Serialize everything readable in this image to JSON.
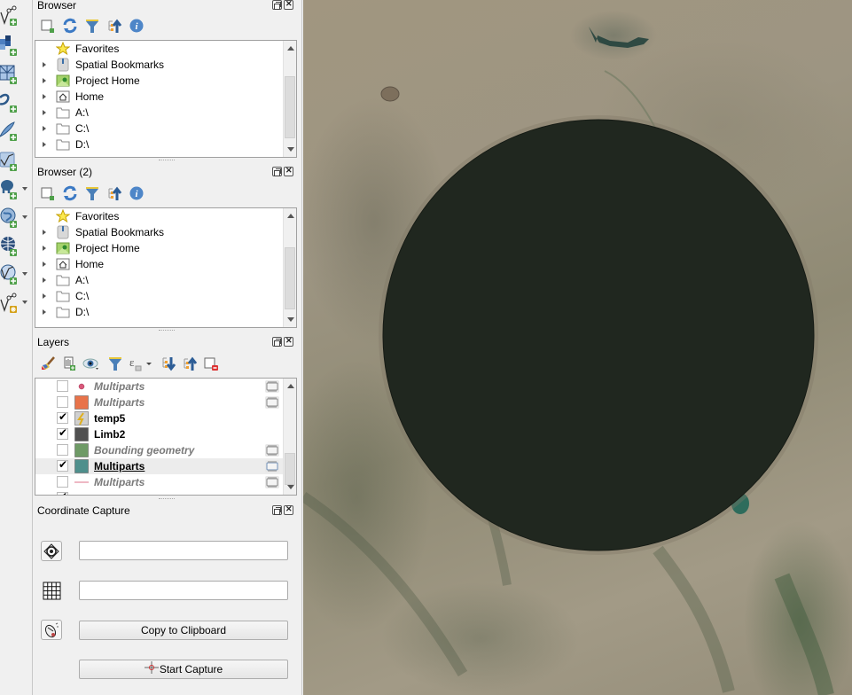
{
  "left_toolbar": {
    "buttons": [
      {
        "name": "add-vector-layer",
        "icon": "vector-add-icon",
        "has_menu": false
      },
      {
        "name": "add-raster-layer",
        "icon": "raster-add-icon",
        "has_menu": false
      },
      {
        "name": "add-mesh-layer",
        "icon": "mesh-add-icon",
        "has_menu": false
      },
      {
        "name": "add-delimited-text-layer",
        "icon": "delimited-text-add-icon",
        "has_menu": false
      },
      {
        "name": "add-spatialite-layer",
        "icon": "spatialite-add-icon",
        "has_menu": false
      },
      {
        "name": "add-virtual-layer",
        "icon": "virtual-layer-add-icon",
        "has_menu": false
      },
      {
        "name": "add-postgis-layer",
        "icon": "postgis-add-icon",
        "has_menu": true
      },
      {
        "name": "add-wms-layer",
        "icon": "wms-add-icon",
        "has_menu": true
      },
      {
        "name": "add-wcs-layer",
        "icon": "wcs-add-icon",
        "has_menu": false
      },
      {
        "name": "add-wfs-layer",
        "icon": "wfs-add-icon",
        "has_menu": true
      },
      {
        "name": "new-shapefile-layer",
        "icon": "new-layer-icon",
        "has_menu": true
      }
    ]
  },
  "browser": {
    "title": "Browser",
    "toolbar": [
      "add-selected-layers-icon",
      "refresh-icon",
      "filter-icon",
      "collapse-all-icon",
      "info-icon"
    ],
    "items": [
      {
        "label": "Favorites",
        "icon": "star-icon",
        "expandable": false
      },
      {
        "label": "Spatial Bookmarks",
        "icon": "bookmark-icon",
        "expandable": true
      },
      {
        "label": "Project Home",
        "icon": "project-home-icon",
        "expandable": true
      },
      {
        "label": "Home",
        "icon": "home-folder-icon",
        "expandable": true
      },
      {
        "label": "A:\\",
        "icon": "folder-icon",
        "expandable": true
      },
      {
        "label": "C:\\",
        "icon": "folder-icon",
        "expandable": true
      },
      {
        "label": "D:\\",
        "icon": "folder-icon",
        "expandable": true
      }
    ]
  },
  "browser2": {
    "title": "Browser (2)",
    "items": [
      {
        "label": "Favorites",
        "icon": "star-icon",
        "expandable": false
      },
      {
        "label": "Spatial Bookmarks",
        "icon": "bookmark-icon",
        "expandable": true
      },
      {
        "label": "Project Home",
        "icon": "project-home-icon",
        "expandable": true
      },
      {
        "label": "Home",
        "icon": "home-folder-icon",
        "expandable": true
      },
      {
        "label": "A:\\",
        "icon": "folder-icon",
        "expandable": true
      },
      {
        "label": "C:\\",
        "icon": "folder-icon",
        "expandable": true
      },
      {
        "label": "D:\\",
        "icon": "folder-icon",
        "expandable": true
      }
    ]
  },
  "layers": {
    "title": "Layers",
    "toolbar": [
      "style-panel-icon",
      "add-group-icon",
      "visibility-menu-icon",
      "filter-legend-icon",
      "filter-expression-icon",
      "expand-all-icon",
      "collapse-all-icon",
      "remove-layer-icon"
    ],
    "items": [
      {
        "label": "Multiparts",
        "checked": false,
        "symbol": "point",
        "color": "#d9587a",
        "visible": false,
        "current": false,
        "memory_indicator": true
      },
      {
        "label": "Multiparts",
        "checked": false,
        "symbol": "fill",
        "color": "#e8734a",
        "visible": false,
        "current": false,
        "memory_indicator": true
      },
      {
        "label": "temp5",
        "checked": true,
        "symbol": "raster",
        "color": "#d0d0d0",
        "visible": true,
        "current": false,
        "memory_indicator": false
      },
      {
        "label": "Limb2",
        "checked": true,
        "symbol": "fill",
        "color": "#505050",
        "visible": true,
        "current": false,
        "memory_indicator": false
      },
      {
        "label": "Bounding geometry",
        "checked": false,
        "symbol": "fill",
        "color": "#6e9a66",
        "visible": false,
        "current": false,
        "memory_indicator": true
      },
      {
        "label": "Multiparts",
        "checked": true,
        "symbol": "fill",
        "color": "#4e8f8c",
        "visible": true,
        "current": true,
        "memory_indicator": true
      },
      {
        "label": "Multiparts",
        "checked": false,
        "symbol": "line",
        "color": "#e8a0b0",
        "visible": false,
        "current": false,
        "memory_indicator": true
      }
    ]
  },
  "coordinate_capture": {
    "title": "Coordinate Capture",
    "crs_button_icon": "crs-selector-icon",
    "crs_coordinate_value": "",
    "canvas_icon": "grid-icon",
    "canvas_coordinate_value": "",
    "track_mouse_icon": "mouse-track-icon",
    "copy_label": "Copy to Clipboard",
    "start_label": "Start Capture",
    "start_icon": "crosshair-icon"
  },
  "map": {
    "circle_fill": "#20271f",
    "basemap": "satellite imagery"
  }
}
